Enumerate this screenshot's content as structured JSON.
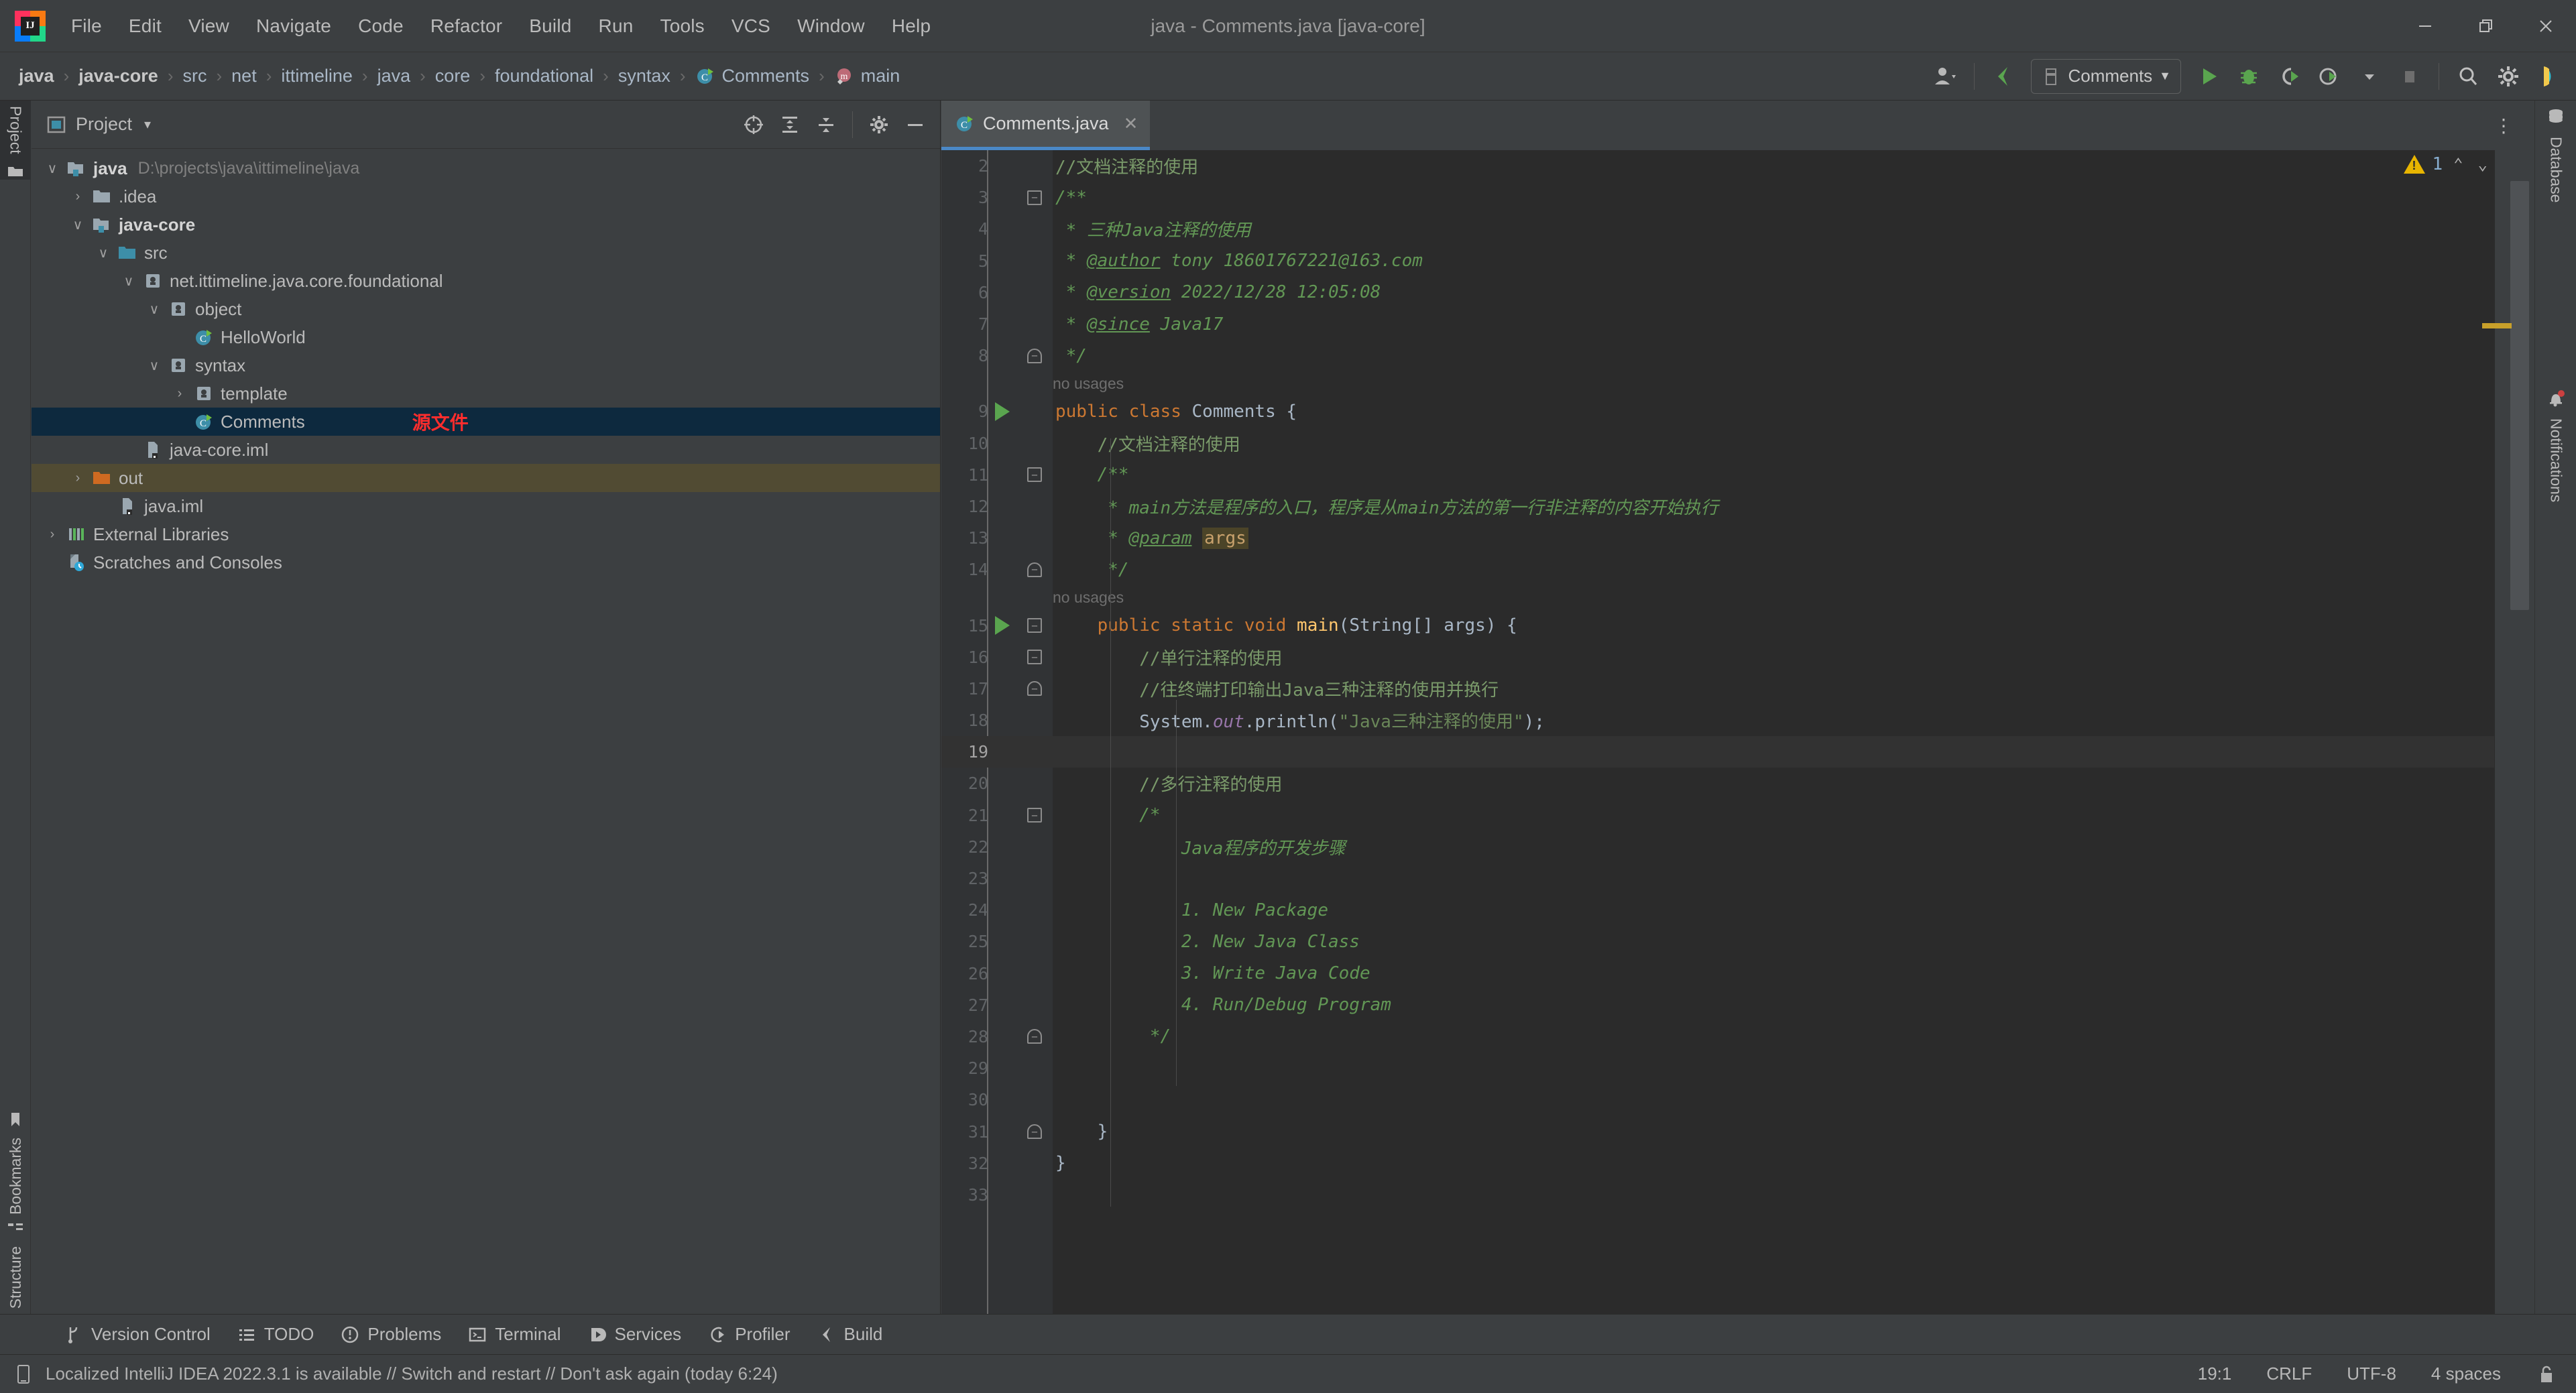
{
  "window": {
    "title": "java - Comments.java [java-core]",
    "minimize_label": "—",
    "maximize_label": "❐",
    "close_label": "✕"
  },
  "menubar": {
    "items": [
      {
        "label": "File"
      },
      {
        "label": "Edit"
      },
      {
        "label": "View"
      },
      {
        "label": "Navigate"
      },
      {
        "label": "Code"
      },
      {
        "label": "Refactor"
      },
      {
        "label": "Build"
      },
      {
        "label": "Run"
      },
      {
        "label": "Tools"
      },
      {
        "label": "VCS"
      },
      {
        "label": "Window"
      },
      {
        "label": "Help"
      }
    ]
  },
  "breadcrumb": {
    "items": [
      {
        "label": "java",
        "bold": true,
        "icon": ""
      },
      {
        "label": "java-core",
        "bold": true,
        "icon": ""
      },
      {
        "label": "src",
        "bold": false,
        "icon": ""
      },
      {
        "label": "net",
        "bold": false,
        "icon": ""
      },
      {
        "label": "ittimeline",
        "bold": false,
        "icon": ""
      },
      {
        "label": "java",
        "bold": false,
        "icon": ""
      },
      {
        "label": "core",
        "bold": false,
        "icon": ""
      },
      {
        "label": "foundational",
        "bold": false,
        "icon": ""
      },
      {
        "label": "syntax",
        "bold": false,
        "icon": ""
      },
      {
        "label": "Comments",
        "bold": false,
        "icon": "java-class-icon"
      },
      {
        "label": "main",
        "bold": false,
        "icon": "method-icon"
      }
    ],
    "separator": "›"
  },
  "toolbar": {
    "account_icon": "user-avatar-icon",
    "updates_icon": "build-arrow-icon",
    "run_config": {
      "label": "Comments",
      "icon": "run-config-icon",
      "caret": "▼"
    },
    "run_label": "Run",
    "debug_label": "Debug",
    "run_coverage_label": "Run with Coverage",
    "profile_label": "Profile",
    "stop_label": "Stop",
    "search_label": "Search Everywhere",
    "settings_label": "Settings",
    "ide_label": "IDE and Project Settings"
  },
  "left_tool_strip": {
    "tabs": [
      {
        "label": "Project",
        "icon": "project-icon",
        "active": true
      },
      {
        "label": "Bookmarks",
        "icon": "bookmark-icon",
        "active": false
      },
      {
        "label": "Structure",
        "icon": "structure-icon",
        "active": false
      }
    ]
  },
  "right_tool_strip": {
    "tabs": [
      {
        "label": "Database",
        "icon": "database-icon"
      },
      {
        "label": "Notifications",
        "icon": "bell-icon"
      }
    ]
  },
  "project_panel": {
    "title": "Project",
    "caret": "▾",
    "icon": "project-view-icon",
    "actions": [
      {
        "name": "select-opened-file",
        "icon": "crosshair-icon"
      },
      {
        "name": "expand-all",
        "icon": "expand-all-icon"
      },
      {
        "name": "collapse-all",
        "icon": "collapse-all-icon"
      },
      {
        "name": "options",
        "icon": "gear-icon"
      },
      {
        "name": "hide",
        "icon": "minus-icon"
      }
    ],
    "tree": [
      {
        "label": "java",
        "path": "D:\\projects\\java\\ittimeline\\java",
        "indent": 0,
        "arrow": "∨",
        "icon": "module-folder-icon",
        "bold": true,
        "state": "normal"
      },
      {
        "label": ".idea",
        "path": "",
        "indent": 1,
        "arrow": "›",
        "icon": "folder-icon",
        "bold": false,
        "state": "normal"
      },
      {
        "label": "java-core",
        "path": "",
        "indent": 1,
        "arrow": "∨",
        "icon": "module-folder-icon",
        "bold": true,
        "state": "normal"
      },
      {
        "label": "src",
        "path": "",
        "indent": 2,
        "arrow": "∨",
        "icon": "source-folder-icon",
        "bold": false,
        "state": "normal"
      },
      {
        "label": "net.ittimeline.java.core.foundational",
        "path": "",
        "indent": 3,
        "arrow": "∨",
        "icon": "package-icon",
        "bold": false,
        "state": "normal"
      },
      {
        "label": "object",
        "path": "",
        "indent": 4,
        "arrow": "∨",
        "icon": "package-icon",
        "bold": false,
        "state": "normal"
      },
      {
        "label": "HelloWorld",
        "path": "",
        "indent": 5,
        "arrow": "",
        "icon": "java-class-icon",
        "bold": false,
        "state": "normal"
      },
      {
        "label": "syntax",
        "path": "",
        "indent": 4,
        "arrow": "∨",
        "icon": "package-icon",
        "bold": false,
        "state": "normal"
      },
      {
        "label": "template",
        "path": "",
        "indent": 5,
        "arrow": "›",
        "icon": "package-icon",
        "bold": false,
        "state": "normal"
      },
      {
        "label": "Comments",
        "path": "",
        "indent": 5,
        "arrow": "",
        "icon": "java-class-icon",
        "bold": false,
        "state": "selected",
        "annotation": "源文件"
      },
      {
        "label": "java-core.iml",
        "path": "",
        "indent": 3,
        "arrow": "",
        "icon": "iml-file-icon",
        "bold": false,
        "state": "normal"
      },
      {
        "label": "out",
        "path": "",
        "indent": 1,
        "arrow": "›",
        "icon": "out-folder-icon",
        "bold": false,
        "state": "excluded"
      },
      {
        "label": "java.iml",
        "path": "",
        "indent": 2,
        "arrow": "",
        "icon": "iml-file-icon",
        "bold": false,
        "state": "normal"
      },
      {
        "label": "External Libraries",
        "path": "",
        "indent": 0,
        "arrow": "›",
        "icon": "libraries-icon",
        "bold": false,
        "state": "normal"
      },
      {
        "label": "Scratches and Consoles",
        "path": "",
        "indent": 0,
        "arrow": "",
        "icon": "scratches-icon",
        "bold": false,
        "state": "normal"
      }
    ]
  },
  "editor": {
    "tab": {
      "label": "Comments.java",
      "icon": "java-class-icon",
      "close": "✕"
    },
    "options_icon": "more-vertical-icon",
    "inspection": {
      "warning_count": "1",
      "warning_icon": "warning-triangle-icon",
      "prev_icon": "⌃",
      "next_icon": "⌄"
    },
    "hints": [
      {
        "after_line": 8,
        "text": "no usages"
      },
      {
        "after_line": 14,
        "text": "no usages"
      }
    ],
    "current_line": 19,
    "lines": [
      {
        "n": 2,
        "indent": 0,
        "tokens": [
          {
            "t": "//文档注释的使用",
            "c": "c-lcmt"
          }
        ]
      },
      {
        "n": 3,
        "indent": 0,
        "fold": "minus",
        "tokens": [
          {
            "t": "/**",
            "c": "c-cmt"
          }
        ]
      },
      {
        "n": 4,
        "indent": 0,
        "tokens": [
          {
            "t": " * 三种Java注释的使用",
            "c": "c-cmt"
          }
        ]
      },
      {
        "n": 5,
        "indent": 0,
        "tokens": [
          {
            "t": " * ",
            "c": "c-cmt"
          },
          {
            "t": "@author",
            "c": "c-tag"
          },
          {
            "t": " tony 18601767221@163.com",
            "c": "c-cmt"
          }
        ]
      },
      {
        "n": 6,
        "indent": 0,
        "tokens": [
          {
            "t": " * ",
            "c": "c-cmt"
          },
          {
            "t": "@version",
            "c": "c-tag"
          },
          {
            "t": " 2022/12/28 12:05:08",
            "c": "c-cmt"
          }
        ]
      },
      {
        "n": 7,
        "indent": 0,
        "tokens": [
          {
            "t": " * ",
            "c": "c-cmt"
          },
          {
            "t": "@since",
            "c": "c-tag"
          },
          {
            "t": " Java17",
            "c": "c-cmt"
          }
        ]
      },
      {
        "n": 8,
        "indent": 0,
        "fold": "end",
        "tokens": [
          {
            "t": " */",
            "c": "c-cmt"
          }
        ]
      },
      {
        "n": 9,
        "indent": 0,
        "run": true,
        "tokens": [
          {
            "t": "public ",
            "c": "c-kw"
          },
          {
            "t": "class ",
            "c": "c-kw"
          },
          {
            "t": "Comments ",
            "c": "c-cls"
          },
          {
            "t": "{",
            "c": "c-brace"
          }
        ]
      },
      {
        "n": 10,
        "indent": 1,
        "tokens": [
          {
            "t": "    //文档注释的使用",
            "c": "c-lcmt"
          }
        ]
      },
      {
        "n": 11,
        "indent": 1,
        "fold": "minus",
        "tokens": [
          {
            "t": "    /**",
            "c": "c-cmt"
          }
        ]
      },
      {
        "n": 12,
        "indent": 1,
        "tokens": [
          {
            "t": "     * main方法是程序的入口，程序是从main方法的第一行非注释的内容开始执行",
            "c": "c-cmt"
          }
        ]
      },
      {
        "n": 13,
        "indent": 1,
        "tokens": [
          {
            "t": "     * ",
            "c": "c-cmt"
          },
          {
            "t": "@param",
            "c": "c-tag"
          },
          {
            "t": " ",
            "c": "c-cmt"
          },
          {
            "t": "args",
            "c": "hl-args"
          }
        ]
      },
      {
        "n": 14,
        "indent": 1,
        "fold": "end",
        "tokens": [
          {
            "t": "     */",
            "c": "c-cmt"
          }
        ]
      },
      {
        "n": 15,
        "indent": 1,
        "run": true,
        "fold": "minus",
        "tokens": [
          {
            "t": "    public ",
            "c": "c-kw"
          },
          {
            "t": "static ",
            "c": "c-kw"
          },
          {
            "t": "void ",
            "c": "c-kw"
          },
          {
            "t": "main",
            "c": "c-meth"
          },
          {
            "t": "(String[] args) {",
            "c": "c-txt"
          }
        ]
      },
      {
        "n": 16,
        "indent": 2,
        "fold": "minus",
        "tokens": [
          {
            "t": "        //单行注释的使用",
            "c": "c-lcmt"
          }
        ]
      },
      {
        "n": 17,
        "indent": 2,
        "fold": "end",
        "tokens": [
          {
            "t": "        //往终端打印输出Java三种注释的使用并换行",
            "c": "c-lcmt"
          }
        ]
      },
      {
        "n": 18,
        "indent": 2,
        "tokens": [
          {
            "t": "        System.",
            "c": "c-txt"
          },
          {
            "t": "out",
            "c": "c-static"
          },
          {
            "t": ".println(",
            "c": "c-txt"
          },
          {
            "t": "\"Java三种注释的使用\"",
            "c": "c-str"
          },
          {
            "t": ");",
            "c": "c-txt"
          }
        ]
      },
      {
        "n": 19,
        "indent": 2,
        "current": true,
        "tokens": []
      },
      {
        "n": 20,
        "indent": 2,
        "tokens": [
          {
            "t": "        //多行注释的使用",
            "c": "c-lcmt"
          }
        ]
      },
      {
        "n": 21,
        "indent": 2,
        "fold": "minus",
        "tokens": [
          {
            "t": "        /*",
            "c": "c-cmt"
          }
        ]
      },
      {
        "n": 22,
        "indent": 2,
        "tokens": [
          {
            "t": "            Java程序的开发步骤",
            "c": "c-cmt"
          }
        ]
      },
      {
        "n": 23,
        "indent": 2,
        "tokens": []
      },
      {
        "n": 24,
        "indent": 2,
        "tokens": [
          {
            "t": "            1. New Package",
            "c": "c-cmt"
          }
        ]
      },
      {
        "n": 25,
        "indent": 2,
        "tokens": [
          {
            "t": "            2. New Java Class",
            "c": "c-cmt"
          }
        ]
      },
      {
        "n": 26,
        "indent": 2,
        "tokens": [
          {
            "t": "            3. Write Java Code",
            "c": "c-cmt"
          }
        ]
      },
      {
        "n": 27,
        "indent": 2,
        "tokens": [
          {
            "t": "            4. Run/Debug Program",
            "c": "c-cmt"
          }
        ]
      },
      {
        "n": 28,
        "indent": 2,
        "fold": "end",
        "tokens": [
          {
            "t": "         */",
            "c": "c-cmt"
          }
        ]
      },
      {
        "n": 29,
        "indent": 2,
        "tokens": []
      },
      {
        "n": 30,
        "indent": 2,
        "tokens": []
      },
      {
        "n": 31,
        "indent": 1,
        "fold": "end",
        "tokens": [
          {
            "t": "    }",
            "c": "c-txt"
          }
        ]
      },
      {
        "n": 32,
        "indent": 0,
        "tokens": [
          {
            "t": "}",
            "c": "c-txt"
          }
        ]
      },
      {
        "n": 33,
        "indent": 0,
        "tokens": []
      }
    ]
  },
  "bottom_tools": {
    "items": [
      {
        "label": "Version Control",
        "icon": "vcs-branch-icon"
      },
      {
        "label": "TODO",
        "icon": "todo-list-icon"
      },
      {
        "label": "Problems",
        "icon": "problems-icon"
      },
      {
        "label": "Terminal",
        "icon": "terminal-icon"
      },
      {
        "label": "Services",
        "icon": "services-icon"
      },
      {
        "label": "Profiler",
        "icon": "profiler-icon"
      },
      {
        "label": "Build",
        "icon": "build-icon"
      }
    ]
  },
  "status_bar": {
    "message_icon": "notification-note-icon",
    "message": "Localized IntelliJ IDEA 2022.3.1 is available // Switch and restart // Don't ask again (today 6:24)",
    "caret_position": "19:1",
    "line_separator": "CRLF",
    "encoding": "UTF-8",
    "indent": "4 spaces",
    "lock_icon": "unlocked-padlock-icon"
  },
  "colors": {
    "bg_chrome": "#3c3f41",
    "bg_editor": "#2b2b2b",
    "bg_gutter": "#313335",
    "selection_blue": "#0d293e",
    "excluded_olive": "#514b33",
    "accent_blue": "#4a88c7",
    "annotation_red": "#ff2d2d",
    "comment_green": "#629755",
    "keyword_orange": "#cc7832",
    "string_green": "#6a8759",
    "warning_yellow": "#e8b500"
  }
}
